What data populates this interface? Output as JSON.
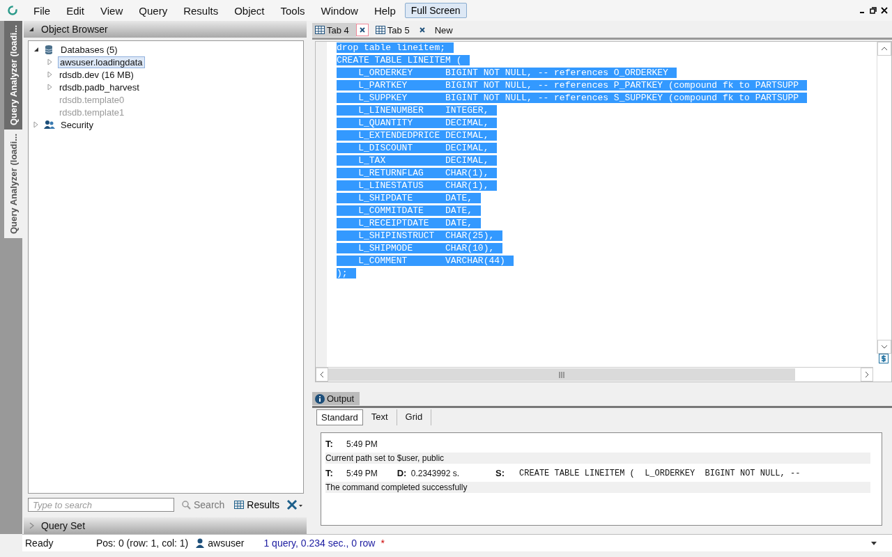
{
  "menu": {
    "items": [
      "File",
      "Edit",
      "View",
      "Query",
      "Results",
      "Object",
      "Tools",
      "Window",
      "Help"
    ],
    "full_screen": "Full Screen"
  },
  "side_tabs": [
    {
      "label": "Query Analyzer (loadi...",
      "selected": true
    },
    {
      "label": "Query Analyzer (loadi...",
      "selected": false
    }
  ],
  "object_browser": {
    "title": "Object Browser",
    "tree": [
      {
        "label": "Databases (5)",
        "kind": "database",
        "expanded": true,
        "selected": false,
        "disabled": false,
        "children": [
          {
            "label": "awsuser.loadingdata",
            "selected": true,
            "disabled": false
          },
          {
            "label": "rdsdb.dev (16 MB)",
            "selected": false,
            "disabled": false
          },
          {
            "label": "rdsdb.padb_harvest",
            "selected": false,
            "disabled": false
          },
          {
            "label": "rdsdb.template0",
            "selected": false,
            "disabled": true
          },
          {
            "label": "rdsdb.template1",
            "selected": false,
            "disabled": true
          }
        ]
      },
      {
        "label": "Security",
        "kind": "security",
        "expanded": false,
        "selected": false,
        "disabled": false
      }
    ],
    "search": {
      "placeholder": "Type to search"
    },
    "search_button": "Search",
    "results_button": "Results"
  },
  "query_set": {
    "title": "Query Set"
  },
  "editor_tabs": [
    {
      "label": "Tab 4",
      "selected": true
    },
    {
      "label": "Tab 5",
      "selected": false
    },
    {
      "label": "New",
      "kind": "new",
      "selected": false
    }
  ],
  "editor": {
    "lines": [
      "drop table lineitem;",
      "CREATE TABLE LINEITEM (",
      "    L_ORDERKEY      BIGINT NOT NULL, -- references O_ORDERKEY",
      "    L_PARTKEY       BIGINT NOT NULL, -- references P_PARTKEY (compound fk to PARTSUPP",
      "    L_SUPPKEY       BIGINT NOT NULL, -- references S_SUPPKEY (compound fk to PARTSUPP",
      "    L_LINENUMBER    INTEGER,",
      "    L_QUANTITY      DECIMAL,",
      "    L_EXTENDEDPRICE DECIMAL,",
      "    L_DISCOUNT      DECIMAL,",
      "    L_TAX           DECIMAL,",
      "    L_RETURNFLAG    CHAR(1),",
      "    L_LINESTATUS    CHAR(1),",
      "    L_SHIPDATE      DATE,",
      "    L_COMMITDATE    DATE,",
      "    L_RECEIPTDATE   DATE,",
      "    L_SHIPINSTRUCT  CHAR(25),",
      "    L_SHIPMODE      CHAR(10),",
      "    L_COMMENT       VARCHAR(44)",
      ");"
    ],
    "selected": true
  },
  "output": {
    "title": "Output",
    "tabs": [
      {
        "label": "Standard",
        "selected": true
      },
      {
        "label": "Text",
        "selected": false
      },
      {
        "label": "Grid",
        "selected": false
      }
    ],
    "entries": [
      {
        "t_label": "T:",
        "time": "5:49 PM",
        "message": "Current path set to $user, public"
      },
      {
        "t_label": "T:",
        "time": "5:49 PM",
        "d_label": "D:",
        "duration": "0.2343992 s.",
        "s_label": "S:",
        "sql": "CREATE TABLE LINEITEM (  L_ORDERKEY  BIGINT NOT NULL, --",
        "message": "The command completed successfully"
      }
    ]
  },
  "status_bar": {
    "state": "Ready",
    "position": "Pos: 0 (row: 1, col: 1)",
    "user": "awsuser",
    "summary": "1 query, 0.234 sec., 0 row",
    "modified": "*"
  }
}
